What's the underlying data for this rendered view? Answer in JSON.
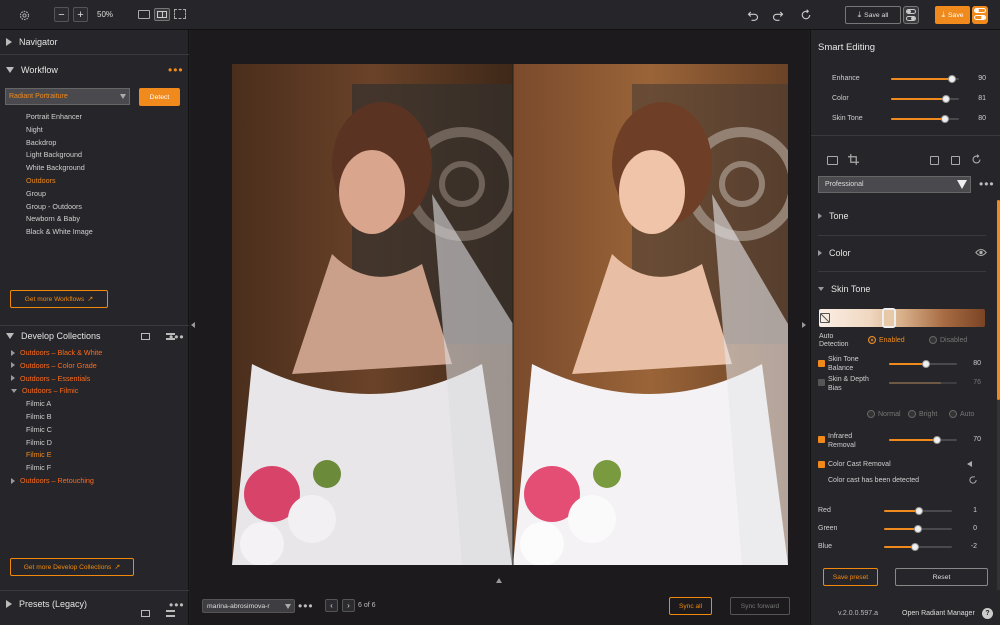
{
  "topbar": {
    "zoom_label": "50%",
    "save_all_label": "Save all",
    "save_label": "Save"
  },
  "left": {
    "navigator_label": "Navigator",
    "workflow_label": "Workflow",
    "workflow_select": "Radiant Portraiture",
    "detect_label": "Detect",
    "workflow_items": [
      "Portrait Enhancer",
      "Night",
      "Backdrop",
      "Light Background",
      "White Background",
      "Outdoors",
      "Group",
      "Group - Outdoors",
      "Newborn & Baby",
      "Black & White Image"
    ],
    "workflow_selected": "Outdoors",
    "get_more_workflows": "Get more Workflows",
    "develop_label": "Develop Collections",
    "collections": [
      {
        "label": "Outdoors – Black & White",
        "type": "group"
      },
      {
        "label": "Outdoors – Color Grade",
        "type": "group"
      },
      {
        "label": "Outdoors – Essentials",
        "type": "group"
      },
      {
        "label": "Outdoors – Filmic",
        "type": "group-open"
      },
      {
        "label": "Filmic A",
        "type": "child"
      },
      {
        "label": "Filmic B",
        "type": "child"
      },
      {
        "label": "Filmic C",
        "type": "child"
      },
      {
        "label": "Filmic D",
        "type": "child"
      },
      {
        "label": "Filmic E",
        "type": "child-sel"
      },
      {
        "label": "Filmic F",
        "type": "child"
      },
      {
        "label": "Outdoors – Retouching",
        "type": "group"
      }
    ],
    "get_more_collections": "Get more Develop Collections",
    "presets_label": "Presets (Legacy)"
  },
  "bottom": {
    "file_name": "marina-abrosimova-r",
    "page_counter": "6 of 6",
    "sync_all": "Sync all",
    "sync_forward": "Sync forward"
  },
  "right": {
    "smart_editing": "Smart Editing",
    "smart_sliders": [
      {
        "label": "Enhance",
        "value": 90
      },
      {
        "label": "Color",
        "value": 81
      },
      {
        "label": "Skin Tone",
        "value": 80
      }
    ],
    "preset_select": "Professional",
    "sections": {
      "tone": "Tone",
      "color": "Color",
      "skin_tone": "Skin Tone"
    },
    "auto_detection_label": "Auto Detection",
    "enabled_label": "Enabled",
    "disabled_label": "Disabled",
    "skin_tone_balance": {
      "label": "Skin Tone Balance",
      "value": 80
    },
    "skin_depth_bias": {
      "label": "Skin & Depth Bias",
      "value": 76
    },
    "bias_options": [
      "Normal",
      "Bright",
      "Auto"
    ],
    "infrared_removal": {
      "label": "Infrared Removal",
      "value": 70
    },
    "color_cast_removal": "Color Cast Removal",
    "color_cast_detected": "Color cast has been detected",
    "rgb_sliders": [
      {
        "label": "Red",
        "value": "1",
        "pos": 0.52
      },
      {
        "label": "Green",
        "value": "0",
        "pos": 0.5
      },
      {
        "label": "Blue",
        "value": "-2",
        "pos": 0.46
      }
    ],
    "save_preset": "Save preset",
    "reset": "Reset",
    "version": "v.2.0.0.597.a",
    "open_manager": "Open Radiant Manager",
    "help": "?"
  },
  "colors": {
    "accent": "#f08a1c",
    "collection": "#ff6a1a",
    "panel": "#26262a"
  }
}
